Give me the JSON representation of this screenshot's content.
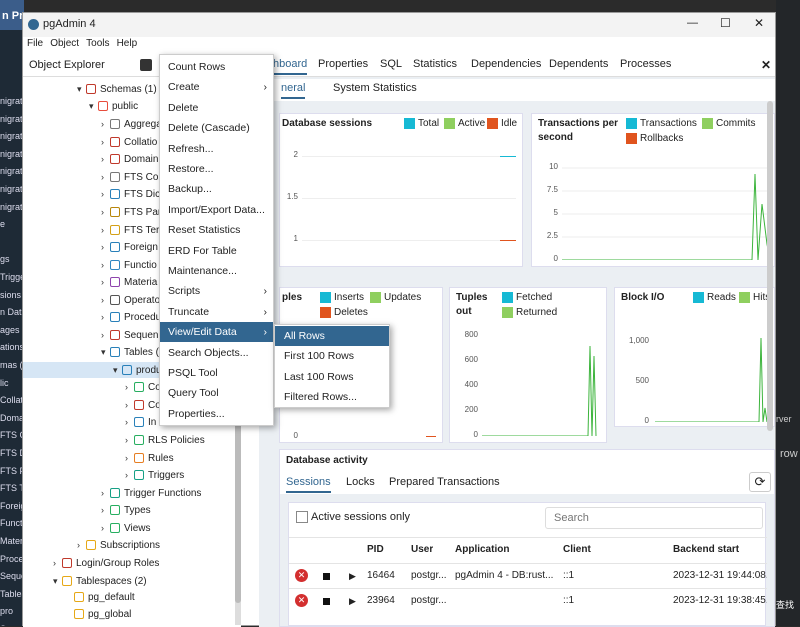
{
  "background": {
    "left_title": "n Pro",
    "left_items": [
      "nigrati",
      "nigrati",
      "nigrati",
      "nigrati",
      "nigrati",
      "nigrati",
      "nigrati",
      "e",
      "",
      "gs",
      "Trigge",
      "sions",
      "n Dat",
      "ages",
      "ations",
      "mas (1",
      "lic",
      "Collati",
      "Doma",
      "FTS C",
      "FTS D",
      "FTS P",
      "FTS T",
      "Foreig",
      "Functi",
      "Mater",
      "Proce",
      "Seque",
      "Tables",
      "pro",
      "Seque"
    ],
    "right_texts": [
      "rver",
      "row",
      "查找"
    ]
  },
  "window": {
    "title": "pgAdmin 4",
    "controls": {
      "minimize": "—",
      "maximize": "☐",
      "close": "✕"
    },
    "menu": [
      "File",
      "Object",
      "Tools",
      "Help"
    ]
  },
  "object_explorer": {
    "title": "Object Explorer",
    "nodes": [
      {
        "label": "Schemas (1)",
        "icon": "schemas-icon"
      },
      {
        "label": "public",
        "icon": "schema-icon"
      },
      {
        "label": "Aggrega",
        "icon": "aggregate-icon"
      },
      {
        "label": "Collatio",
        "icon": "collation-icon"
      },
      {
        "label": "Domain",
        "icon": "domain-icon"
      },
      {
        "label": "FTS Cor",
        "icon": "fts-config-icon"
      },
      {
        "label": "FTS Dic",
        "icon": "fts-dict-icon"
      },
      {
        "label": "FTS Par",
        "icon": "fts-parser-icon"
      },
      {
        "label": "FTS Ter",
        "icon": "fts-template-icon"
      },
      {
        "label": "Foreign",
        "icon": "foreign-table-icon"
      },
      {
        "label": "Functio",
        "icon": "function-icon"
      },
      {
        "label": "Materia",
        "icon": "matview-icon"
      },
      {
        "label": "Operato",
        "icon": "operator-icon"
      },
      {
        "label": "Procedu",
        "icon": "procedure-icon"
      },
      {
        "label": "Sequen",
        "icon": "sequence-icon"
      },
      {
        "label": "Tables (",
        "icon": "tables-icon"
      },
      {
        "label": "produ",
        "icon": "table-icon"
      },
      {
        "label": "Co",
        "icon": "columns-icon"
      },
      {
        "label": "Co",
        "icon": "constraints-icon"
      },
      {
        "label": "In",
        "icon": "indexes-icon"
      },
      {
        "label": "RLS Policies",
        "icon": "rls-icon"
      },
      {
        "label": "Rules",
        "icon": "rules-icon"
      },
      {
        "label": "Triggers",
        "icon": "triggers-icon"
      },
      {
        "label": "Trigger Functions",
        "icon": "trigger-function-icon"
      },
      {
        "label": "Types",
        "icon": "types-icon"
      },
      {
        "label": "Views",
        "icon": "views-icon"
      },
      {
        "label": "Subscriptions",
        "icon": "subscriptions-icon"
      },
      {
        "label": "Login/Group Roles",
        "icon": "roles-icon"
      },
      {
        "label": "Tablespaces (2)",
        "icon": "tablespaces-icon"
      },
      {
        "label": "pg_default",
        "icon": "folder-icon"
      },
      {
        "label": "pg_global",
        "icon": "folder-icon"
      }
    ]
  },
  "tabs": [
    "hboard",
    "Properties",
    "SQL",
    "Statistics",
    "Dependencies",
    "Dependents",
    "Processes"
  ],
  "subtabs": [
    "neral",
    "System Statistics"
  ],
  "panels": {
    "db_sessions": {
      "title": "Database sessions",
      "legend": [
        "Total",
        "Active",
        "Idle"
      ],
      "ticks": [
        "2",
        "1.5",
        "1"
      ]
    },
    "transactions": {
      "title_line1": "Transactions per",
      "title_line2": "second",
      "legend": [
        "Transactions",
        "Commits",
        "Rollbacks"
      ],
      "ticks": [
        "10",
        "7.5",
        "5",
        "2.5",
        "0"
      ]
    },
    "tuples_in": {
      "title_line1": "ples",
      "legend": [
        "Inserts",
        "Updates",
        "Deletes"
      ],
      "ticks": [
        "00",
        "0"
      ]
    },
    "tuples_out": {
      "title_line1": "Tuples",
      "title_line2": "out",
      "legend": [
        "Fetched",
        "Returned"
      ],
      "ticks": [
        "800",
        "600",
        "400",
        "200",
        "0"
      ]
    },
    "block_io": {
      "title": "Block I/O",
      "legend": [
        "Reads",
        "Hits"
      ],
      "ticks": [
        "1,000",
        "500",
        "0"
      ]
    }
  },
  "activity": {
    "title": "Database activity",
    "tabs": [
      "Sessions",
      "Locks",
      "Prepared Transactions"
    ],
    "active_only_label": "Active sessions only",
    "search_placeholder": "Search",
    "columns": [
      "PID",
      "User",
      "Application",
      "Client",
      "Backend start"
    ],
    "rows": [
      {
        "pid": "16464",
        "user": "postgr...",
        "application": "pgAdmin 4 - DB:rust...",
        "client": "::1",
        "backend_start": "2023-12-31 19:44:08."
      },
      {
        "pid": "23964",
        "user": "postgr...",
        "application": "",
        "client": "::1",
        "backend_start": "2023-12-31 19:38:45."
      }
    ]
  },
  "context_menu": {
    "items": [
      {
        "label": "Count Rows",
        "submenu": false
      },
      {
        "label": "Create",
        "submenu": true
      },
      {
        "label": "Delete",
        "submenu": false
      },
      {
        "label": "Delete (Cascade)",
        "submenu": false
      },
      {
        "label": "Refresh...",
        "submenu": false
      },
      {
        "label": "Restore...",
        "submenu": false
      },
      {
        "label": "Backup...",
        "submenu": false
      },
      {
        "label": "Import/Export Data...",
        "submenu": false
      },
      {
        "label": "Reset Statistics",
        "submenu": false
      },
      {
        "label": "ERD For Table",
        "submenu": false
      },
      {
        "label": "Maintenance...",
        "submenu": false
      },
      {
        "label": "Scripts",
        "submenu": true
      },
      {
        "label": "Truncate",
        "submenu": true
      },
      {
        "label": "View/Edit Data",
        "submenu": true
      },
      {
        "label": "Search Objects...",
        "submenu": false
      },
      {
        "label": "PSQL Tool",
        "submenu": false
      },
      {
        "label": "Query Tool",
        "submenu": false
      },
      {
        "label": "Properties...",
        "submenu": false
      }
    ],
    "selected": "View/Edit Data",
    "submenu_items": [
      "All Rows",
      "First 100 Rows",
      "Last 100 Rows",
      "Filtered Rows..."
    ],
    "submenu_selected": "All Rows"
  },
  "colors": {
    "accent": "#326690",
    "total": "#16b9d4",
    "active": "#8fcf5f",
    "idle": "#e0541e",
    "line": "#3cb43c"
  }
}
